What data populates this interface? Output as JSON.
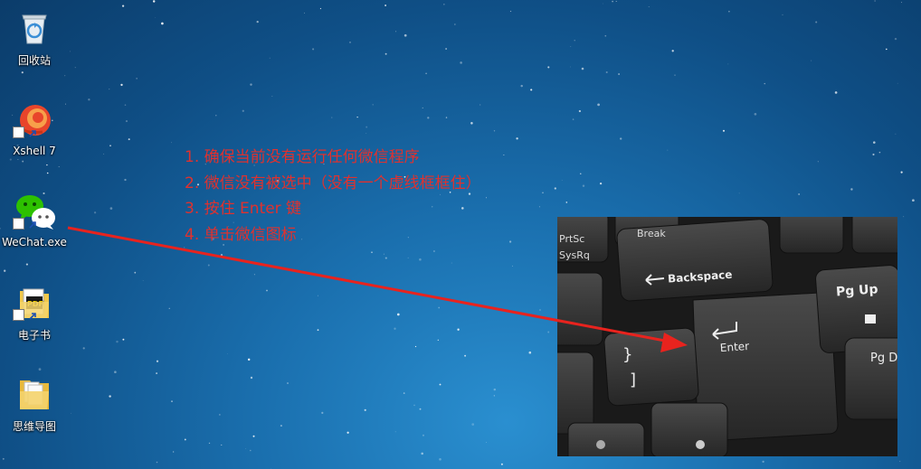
{
  "desktop": {
    "icons": [
      {
        "label": "回收站",
        "icon": "recycle-bin-icon",
        "shortcut": false
      },
      {
        "label": "Xshell 7",
        "icon": "xshell-icon",
        "shortcut": true
      },
      {
        "label": "WeChat.exe",
        "icon": "wechat-icon",
        "shortcut": true
      },
      {
        "label": "电子书",
        "icon": "pdf-folder-icon",
        "shortcut": true
      },
      {
        "label": "思维导图",
        "icon": "folder-icon",
        "shortcut": false
      }
    ]
  },
  "instructions": {
    "steps": [
      "1. 确保当前没有运行任何微信程序",
      "2. 微信没有被选中（没有一个虚线框框住）",
      "3. 按住 Enter 键",
      "4. 单击微信图标"
    ],
    "color": "#e0312e"
  },
  "keyboard_photo": {
    "keys": {
      "sysrq": "SysRq",
      "prtsc": "PrtSc",
      "break": "Break",
      "backspace": "Backspace",
      "enter": "Enter",
      "pgup": "Pg Up",
      "pgdn": "Pg D",
      "brace_open": "{",
      "bracket_open": "[",
      "brace_close": "}",
      "bracket_close": "]"
    }
  }
}
